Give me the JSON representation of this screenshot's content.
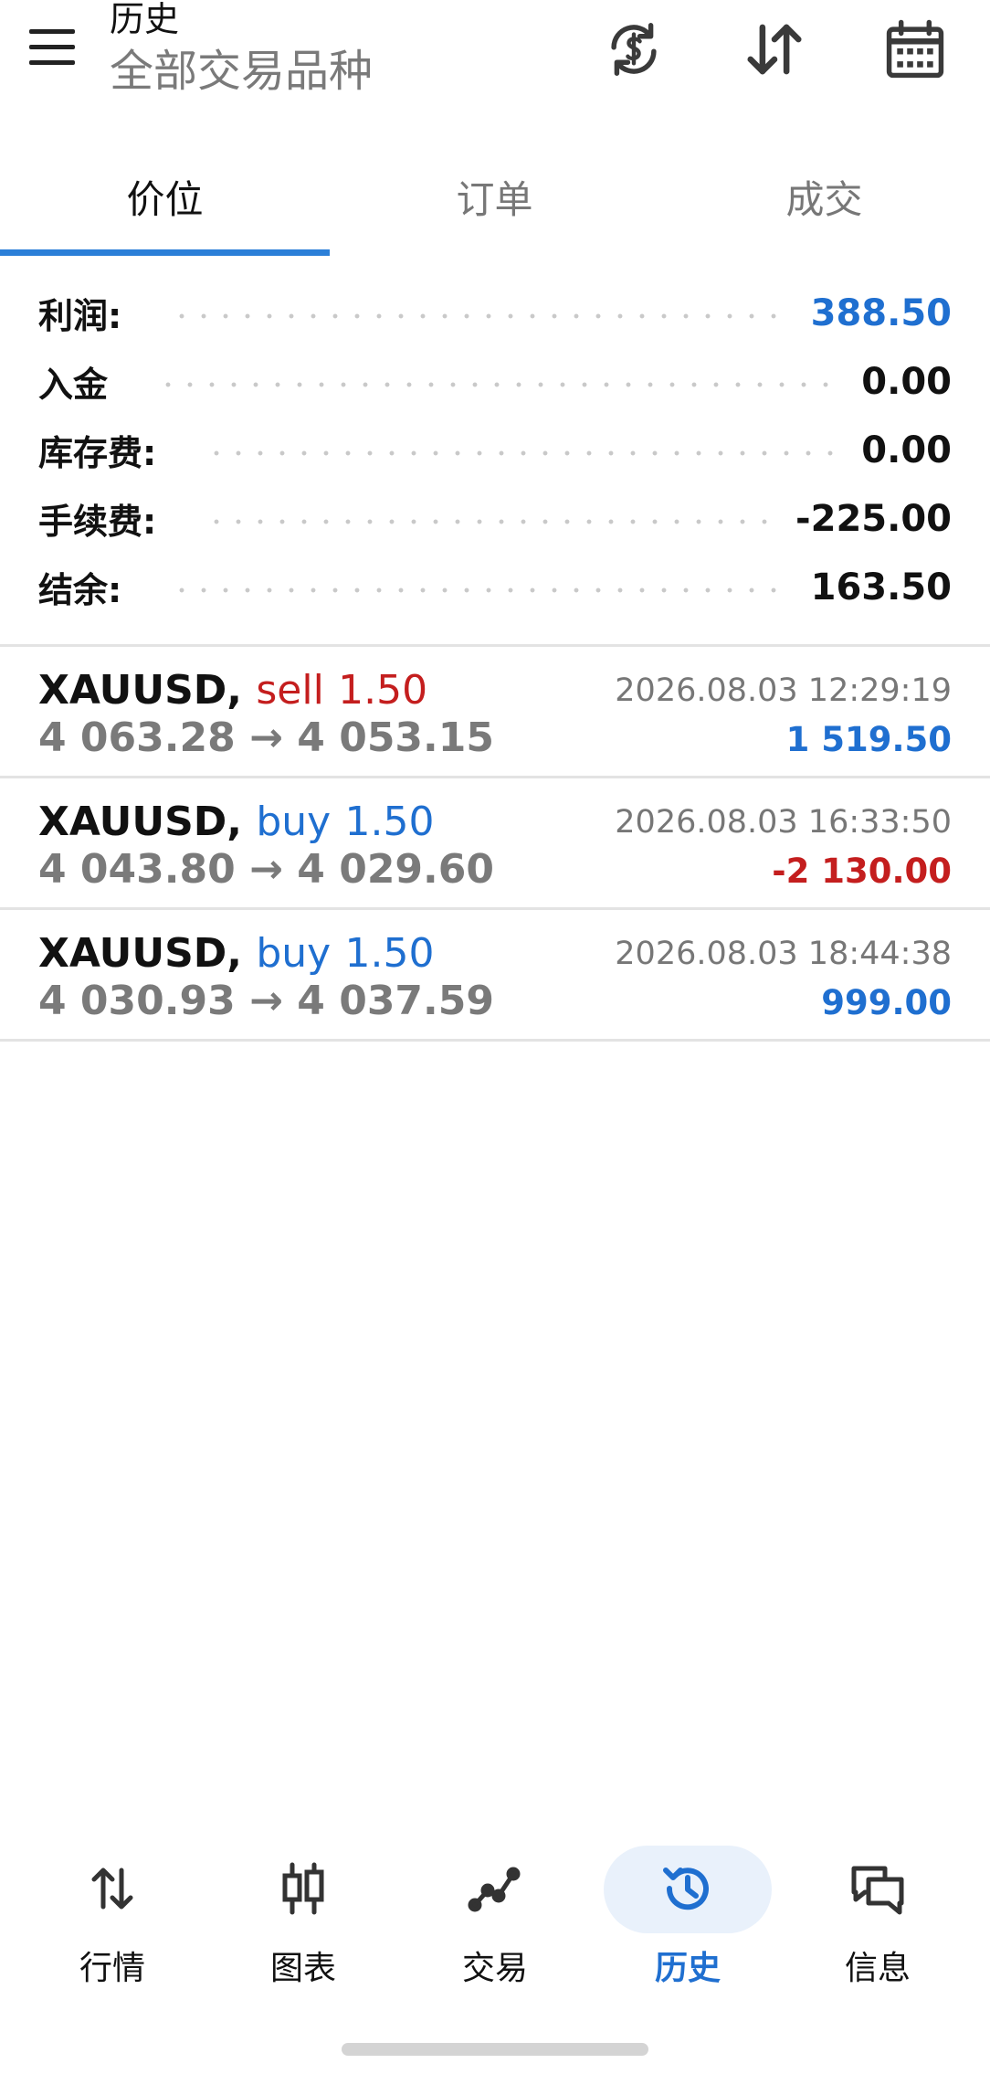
{
  "header": {
    "title": "历史",
    "subtitle": "全部交易品种"
  },
  "tabs": [
    {
      "label": "价位",
      "active": true
    },
    {
      "label": "订单",
      "active": false
    },
    {
      "label": "成交",
      "active": false
    }
  ],
  "summary": [
    {
      "label": "利润:",
      "value": "388.50",
      "highlight": true
    },
    {
      "label": "入金",
      "value": "0.00",
      "highlight": false
    },
    {
      "label": "库存费:",
      "value": "0.00",
      "highlight": false
    },
    {
      "label": "手续费:",
      "value": "-225.00",
      "highlight": false
    },
    {
      "label": "结余:",
      "value": "163.50",
      "highlight": false
    }
  ],
  "deals": [
    {
      "symbol": "XAUUSD,",
      "side": "sell",
      "volume": "1.50",
      "open_price": "4 063.28",
      "arrow": "→",
      "close_price": "4 053.15",
      "time": "2026.08.03 12:29:19",
      "profit": "1 519.50",
      "profit_sign": "pos"
    },
    {
      "symbol": "XAUUSD,",
      "side": "buy",
      "volume": "1.50",
      "open_price": "4 043.80",
      "arrow": "→",
      "close_price": "4 029.60",
      "time": "2026.08.03 16:33:50",
      "profit": "-2 130.00",
      "profit_sign": "neg"
    },
    {
      "symbol": "XAUUSD,",
      "side": "buy",
      "volume": "1.50",
      "open_price": "4 030.93",
      "arrow": "→",
      "close_price": "4 037.59",
      "time": "2026.08.03 18:44:38",
      "profit": "999.00",
      "profit_sign": "pos"
    }
  ],
  "bottom_nav": [
    {
      "label": "行情",
      "icon": "quotes-icon",
      "active": false
    },
    {
      "label": "图表",
      "icon": "chart-icon",
      "active": false
    },
    {
      "label": "交易",
      "icon": "trade-icon",
      "active": false
    },
    {
      "label": "历史",
      "icon": "history-icon",
      "active": true
    },
    {
      "label": "信息",
      "icon": "messages-icon",
      "active": false
    }
  ],
  "colors": {
    "accent": "#1f6fd0",
    "loss": "#c41e1e",
    "tab_indicator": "#2b7fd8",
    "muted": "#7a7a7a"
  }
}
